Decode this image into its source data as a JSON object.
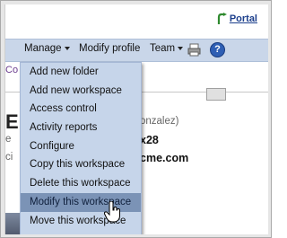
{
  "portal": {
    "label": "Portal",
    "icon": "portal-link-icon"
  },
  "navbar": {
    "manage": "Manage",
    "modify_profile": "Modify profile",
    "team": "Team",
    "print_icon": "printer-icon",
    "help_icon": "help-icon",
    "help_glyph": "?"
  },
  "background": {
    "purple_fragment": "Co",
    "big_letter": "E",
    "name_fragment": "onzalez)",
    "left_fragment_1": "e",
    "bold_fragment_1": "x28",
    "bold_fragment_2": "cme.com",
    "left_fragment_2": "ci"
  },
  "manage_menu": {
    "items": [
      "Add new folder",
      "Add new workspace",
      "Access control",
      "Activity reports",
      "Configure",
      "Copy this workspace",
      "Delete this workspace",
      "Modify this workspace",
      "Move this workspace"
    ],
    "hovered_item": "Modify this workspace"
  },
  "colors": {
    "navbar": "#c9d6e9",
    "menu_bg": "#c6d5ea",
    "menu_hover": "#7b93b6",
    "link": "#1c3f8c",
    "accent_purple": "#6a3b8e"
  }
}
